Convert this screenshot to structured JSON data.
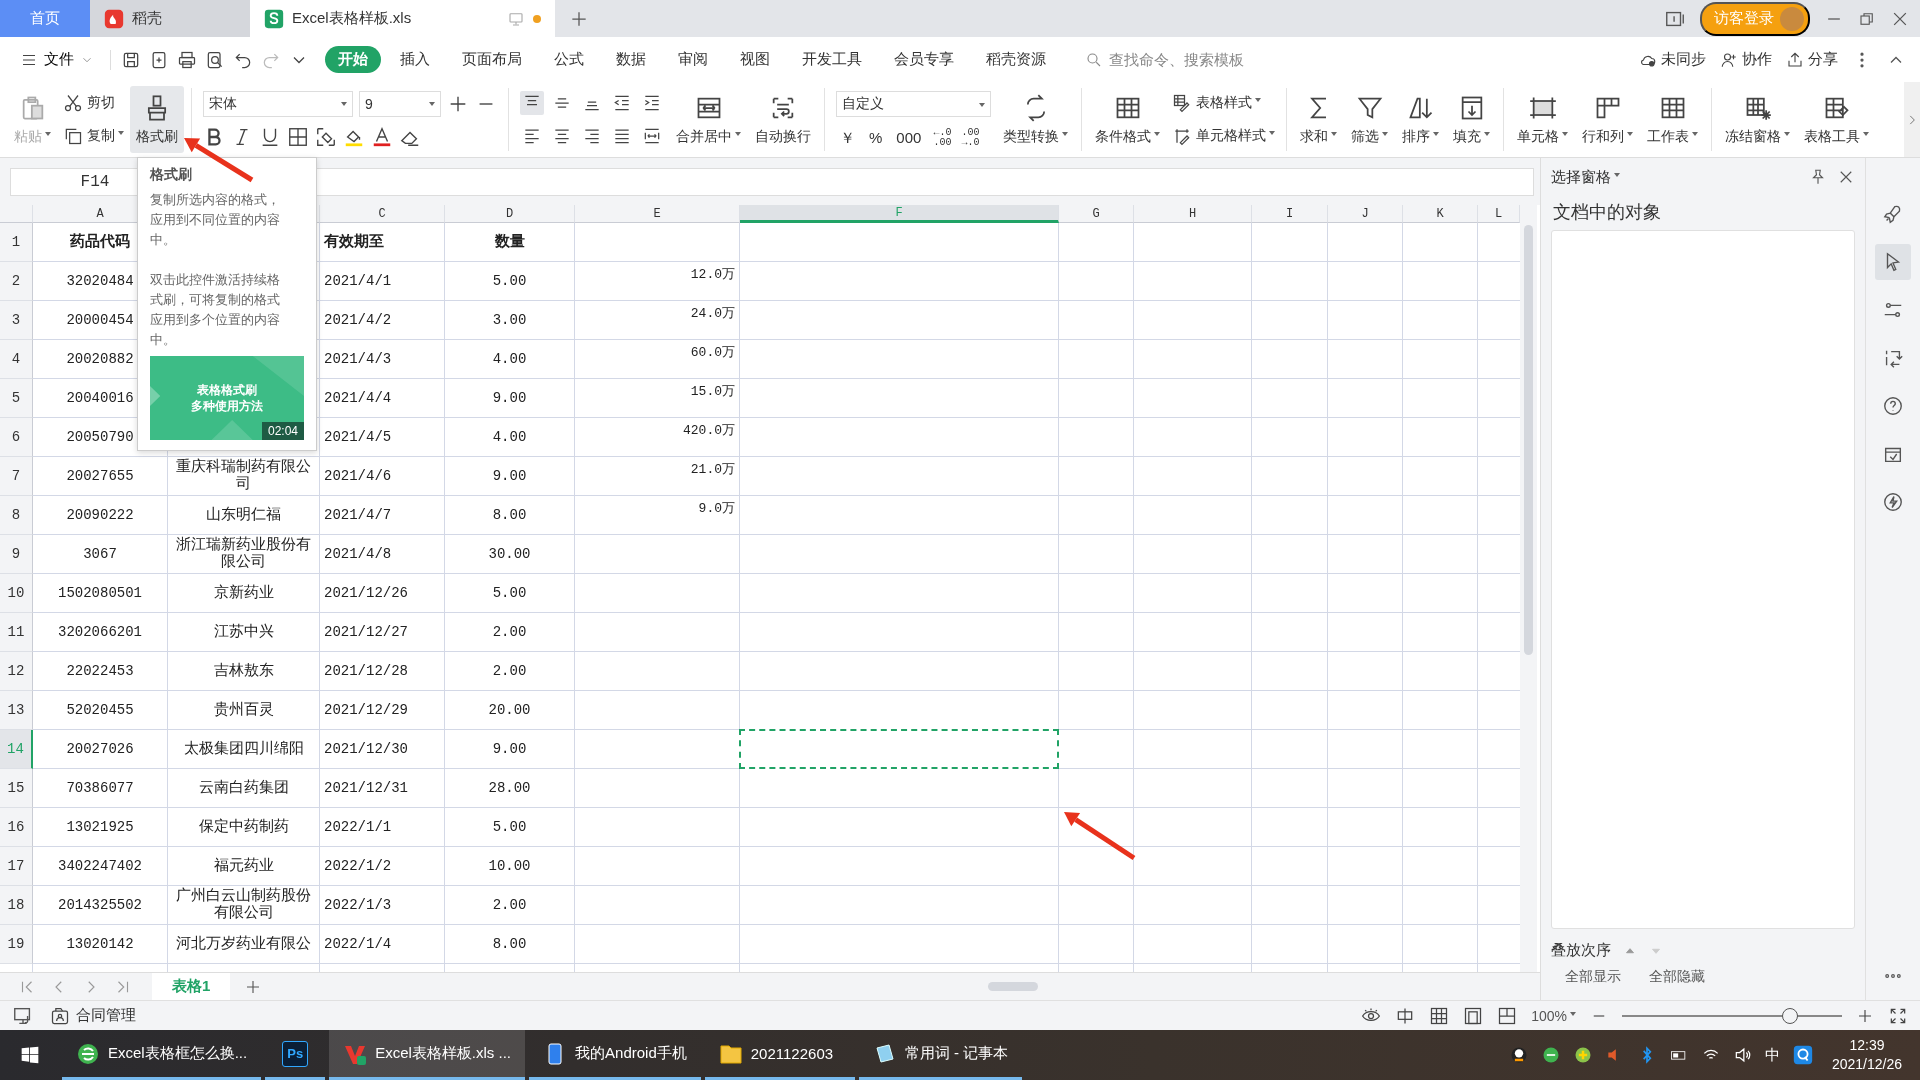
{
  "tabs": [
    {
      "kind": "home",
      "label": "首页",
      "selected": false
    },
    {
      "kind": "docer",
      "label": "稻壳",
      "selected": false
    },
    {
      "kind": "sheet",
      "label": "Excel表格样板.xls",
      "selected": true,
      "unsaved": true
    }
  ],
  "account": {
    "login": "访客登录"
  },
  "menu": {
    "file": "文件",
    "tabs": [
      {
        "label": "开始",
        "selected": true
      },
      {
        "label": "插入",
        "selected": false
      },
      {
        "label": "页面布局",
        "selected": false
      },
      {
        "label": "公式",
        "selected": false
      },
      {
        "label": "数据",
        "selected": false
      },
      {
        "label": "审阅",
        "selected": false
      },
      {
        "label": "视图",
        "selected": false
      },
      {
        "label": "开发工具",
        "selected": false
      },
      {
        "label": "会员专享",
        "selected": false
      },
      {
        "label": "稻壳资源",
        "selected": false
      }
    ],
    "search": {
      "placeholder": "查找命令、搜索模板"
    },
    "actions": [
      "未同步",
      "协作",
      "分享"
    ]
  },
  "ribbon": [
    {
      "kind": "big",
      "label": "粘贴",
      "disabled": true,
      "dropdown": true
    },
    {
      "kind": "pair",
      "items": [
        {
          "label": "剪切",
          "dropdown": false
        },
        {
          "label": "复制",
          "dropdown": true
        }
      ]
    },
    {
      "kind": "big",
      "label": "格式刷",
      "pressed": true
    },
    {
      "kind": "sep"
    },
    {
      "kind": "font",
      "font": "宋体",
      "size": "9"
    },
    {
      "kind": "sep"
    },
    {
      "kind": "align"
    },
    {
      "kind": "big",
      "label": "合并居中",
      "dropdown": true
    },
    {
      "kind": "big",
      "label": "自动换行"
    },
    {
      "kind": "sep"
    },
    {
      "kind": "number",
      "format": "自定义",
      "symbols": [
        {
          "text": "￥"
        },
        {
          "text": "%"
        },
        {
          "text": "000"
        },
        {
          "top": "←.0",
          "bottom": ".00"
        },
        {
          "top": ".00",
          "bottom": "→.0"
        }
      ]
    },
    {
      "kind": "big",
      "label": "类型转换",
      "dropdown": true
    },
    {
      "kind": "sep"
    },
    {
      "kind": "big",
      "label": "条件格式",
      "dropdown": true
    },
    {
      "kind": "pair",
      "items": [
        {
          "label": "表格样式",
          "dropdown": true
        },
        {
          "label": "单元格样式",
          "dropdown": true
        }
      ]
    },
    {
      "kind": "sep"
    },
    {
      "kind": "big",
      "label": "求和",
      "dropdown": true
    },
    {
      "kind": "big",
      "label": "筛选",
      "dropdown": true
    },
    {
      "kind": "big",
      "label": "排序",
      "dropdown": true
    },
    {
      "kind": "big",
      "label": "填充",
      "dropdown": true
    },
    {
      "kind": "sep"
    },
    {
      "kind": "big",
      "label": "单元格",
      "dropdown": true
    },
    {
      "kind": "big",
      "label": "行和列",
      "dropdown": true
    },
    {
      "kind": "big",
      "label": "工作表",
      "dropdown": true
    },
    {
      "kind": "sep"
    },
    {
      "kind": "big",
      "label": "冻结窗格",
      "dropdown": true
    },
    {
      "kind": "big",
      "label": "表格工具",
      "dropdown": true
    }
  ],
  "name_box": "F14",
  "tooltip": {
    "title": "格式刷",
    "paragraphs": [
      "复制所选内容的格式，应用到不同位置的内容中。",
      "双击此控件激活持续格式刷，可将复制的格式应用到多个位置的内容中。"
    ],
    "video": {
      "title_lines": [
        "表格格式刷",
        "多种使用方法"
      ],
      "duration": "02:04"
    }
  },
  "sheet": {
    "columns": [
      {
        "label": "A",
        "selected": false
      },
      {
        "selected": false
      },
      {
        "label": "C",
        "selected": false
      },
      {
        "label": "D",
        "selected": false
      },
      {
        "label": "E",
        "selected": false
      },
      {
        "label": "F",
        "selected": true
      },
      {
        "label": "G",
        "selected": false
      },
      {
        "label": "H",
        "selected": false
      },
      {
        "label": "I",
        "selected": false
      },
      {
        "label": "J",
        "selected": false
      },
      {
        "label": "K",
        "selected": false
      },
      {
        "label": "L",
        "selected": false
      }
    ],
    "rows": [
      {
        "num": "1",
        "selected": false,
        "kind": "header",
        "a": "药品代码",
        "c": "有效期至",
        "d": "数量"
      },
      {
        "num": "2",
        "selected": false,
        "a": "32020484",
        "c": "2021/4/1",
        "d": "5.00",
        "e": "12.0万"
      },
      {
        "num": "3",
        "selected": false,
        "a": "20000454",
        "c": "2021/4/2",
        "d": "3.00",
        "e": "24.0万"
      },
      {
        "num": "4",
        "selected": false,
        "a": "20020882",
        "c": "2021/4/3",
        "d": "4.00",
        "e": "60.0万"
      },
      {
        "num": "5",
        "selected": false,
        "a": "20040016",
        "c": "2021/4/4",
        "d": "9.00",
        "e": "15.0万"
      },
      {
        "num": "6",
        "selected": false,
        "a": "20050790",
        "c": "2021/4/5",
        "d": "4.00",
        "e": "420.0万"
      },
      {
        "num": "7",
        "selected": false,
        "a": "20027655",
        "b": "重庆科瑞制药有限公司",
        "c": "2021/4/6",
        "d": "9.00",
        "e": "21.0万"
      },
      {
        "num": "8",
        "selected": false,
        "a": "20090222",
        "b": "山东明仁福",
        "c": "2021/4/7",
        "d": "8.00",
        "e": "9.0万"
      },
      {
        "num": "9",
        "selected": false,
        "a": "3067",
        "b": "浙江瑞新药业股份有限公司",
        "c": "2021/4/8",
        "d": "30.00"
      },
      {
        "num": "10",
        "selected": false,
        "a": "1502080501",
        "b": "京新药业",
        "c": "2021/12/26",
        "d": "5.00"
      },
      {
        "num": "11",
        "selected": false,
        "a": "3202066201",
        "b": "江苏中兴",
        "c": "2021/12/27",
        "d": "2.00"
      },
      {
        "num": "12",
        "selected": false,
        "a": "22022453",
        "b": "吉林敖东",
        "c": "2021/12/28",
        "d": "2.00"
      },
      {
        "num": "13",
        "selected": false,
        "a": "52020455",
        "b": "贵州百灵",
        "c": "2021/12/29",
        "d": "20.00"
      },
      {
        "num": "14",
        "selected": true,
        "a": "20027026",
        "b": "太极集团四川绵阳",
        "c": "2021/12/30",
        "d": "9.00"
      },
      {
        "num": "15",
        "selected": false,
        "a": "70386077",
        "b": "云南白药集团",
        "c": "2021/12/31",
        "d": "28.00"
      },
      {
        "num": "16",
        "selected": false,
        "a": "13021925",
        "b": "保定中药制药",
        "c": "2022/1/1",
        "d": "5.00"
      },
      {
        "num": "17",
        "selected": false,
        "a": "3402247402",
        "b": "福元药业",
        "c": "2022/1/2",
        "d": "10.00"
      },
      {
        "num": "18",
        "selected": false,
        "a": "2014325502",
        "b": "广州白云山制药股份有限公司",
        "c": "2022/1/3",
        "d": "2.00"
      },
      {
        "num": "19",
        "selected": false,
        "a": "13020142",
        "b": "河北万岁药业有限公",
        "c": "2022/1/4",
        "d": "8.00"
      }
    ],
    "sheet_tabs": [
      {
        "label": "表格1",
        "selected": true
      }
    ]
  },
  "pane": {
    "title": "选择窗格",
    "heading": "文档中的对象",
    "order_label": "叠放次序",
    "buttons": [
      "全部显示",
      "全部隐藏"
    ]
  },
  "side_tools": [
    {
      "selected": false
    },
    {
      "selected": true
    },
    {
      "selected": false
    },
    {
      "selected": false
    },
    {
      "selected": false
    },
    {
      "selected": false
    },
    {
      "selected": false
    }
  ],
  "status_bar": {
    "contract": "合同管理",
    "zoom": "100%",
    "zoom_slider": {
      "level": 0.8
    }
  },
  "taskbar": {
    "items": [
      {
        "label": "Excel表格框怎么换...",
        "selected": false
      },
      {
        "label": "Ps",
        "kind": "ps",
        "selected": false
      },
      {
        "label": "Excel表格样板.xls ...",
        "selected": true
      },
      {
        "label": "我的Android手机",
        "selected": false
      },
      {
        "label": "2021122603",
        "selected": false
      },
      {
        "label": "常用词 - 记事本",
        "selected": false
      }
    ],
    "ime": "中",
    "time": "12:39",
    "date": "2021/12/26"
  }
}
